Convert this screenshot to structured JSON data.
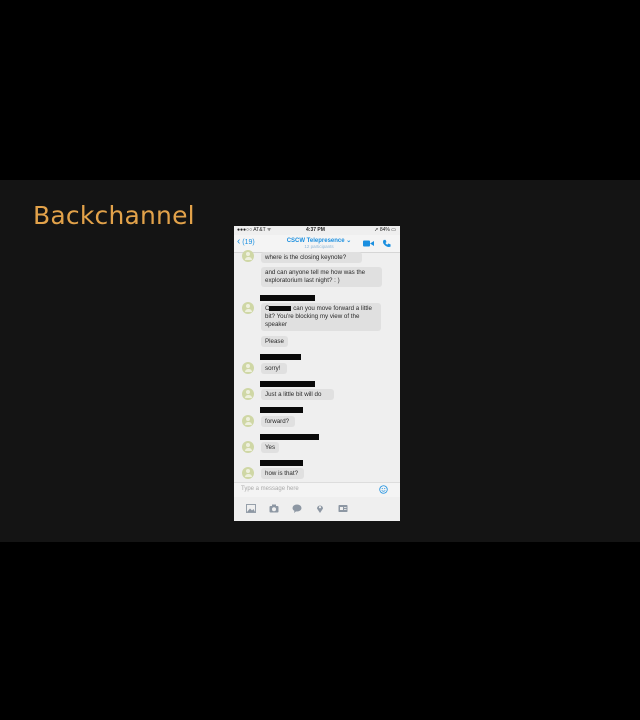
{
  "slide": {
    "title": "Backchannel"
  },
  "status": {
    "carrier": "●●●○○ AT&T ᯤ",
    "time": "4:37 PM",
    "battery": "➚ 84% ▭"
  },
  "nav": {
    "back_count": "(19)",
    "title": "CSCW Telepresence ⌄",
    "subtitle": "12 participants"
  },
  "messages": [
    {
      "text": "where is the closing keynote?"
    },
    {
      "text": "and can anyone tell me how was the exploratorium last night? : )"
    },
    {
      "text_before": "C",
      "text_after": " can you move forward a little bit? You're blocking my view of the speaker"
    },
    {
      "text": "Please"
    },
    {
      "text": "sorry!"
    },
    {
      "text": "Just a little bit will do"
    },
    {
      "text": "forward?"
    },
    {
      "text": "Yes"
    },
    {
      "text": "how is that?"
    }
  ],
  "input": {
    "placeholder": "Type a message here"
  },
  "icons": {
    "back": "chevron-left-icon",
    "video": "video-call-icon",
    "phone": "phone-call-icon",
    "emoji": "emoji-icon",
    "toolbar": [
      "image-icon",
      "camera-icon",
      "chat-bubble-icon",
      "location-pin-icon",
      "contact-card-icon"
    ]
  },
  "colors": {
    "accent": "#1a8fe0",
    "title": "#e2a24a",
    "bubble": "#e0e0e0",
    "avatar": "#cfd7a5"
  }
}
